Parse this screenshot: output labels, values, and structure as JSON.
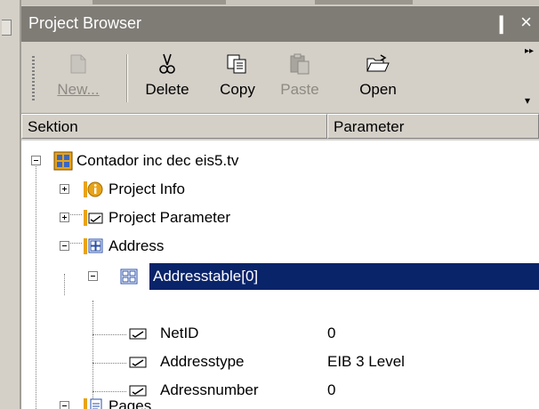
{
  "panel": {
    "title": "Project Browser",
    "pin_glyph": "❙",
    "close_glyph": "×"
  },
  "toolbar": {
    "buttons": [
      {
        "label": "New...",
        "icon": "new-document-icon",
        "enabled": false
      },
      {
        "label": "Delete",
        "icon": "scissors-icon",
        "enabled": true
      },
      {
        "label": "Copy",
        "icon": "copy-icon",
        "enabled": true
      },
      {
        "label": "Paste",
        "icon": "paste-icon",
        "enabled": false
      },
      {
        "label": "Open",
        "icon": "open-folder-icon",
        "enabled": true
      }
    ]
  },
  "columns": {
    "section": "Sektion",
    "parameter": "Parameter"
  },
  "tree": {
    "root": "Contador inc dec eis5.tv",
    "project_info": "Project Info",
    "project_parameter": "Project Parameter",
    "address": "Address",
    "addresstable": "Addresstable[0]",
    "netid": {
      "label": "NetID",
      "value": "0"
    },
    "addresstype": {
      "label": "Addresstype",
      "value": "EIB 3 Level"
    },
    "adressnumber": {
      "label": "Adressnumber",
      "value": "0"
    },
    "pages": "Pages"
  },
  "colors": {
    "selection": "#0a246a",
    "titlebar": "#7f7c76",
    "folder_accent": "#e8a317"
  }
}
